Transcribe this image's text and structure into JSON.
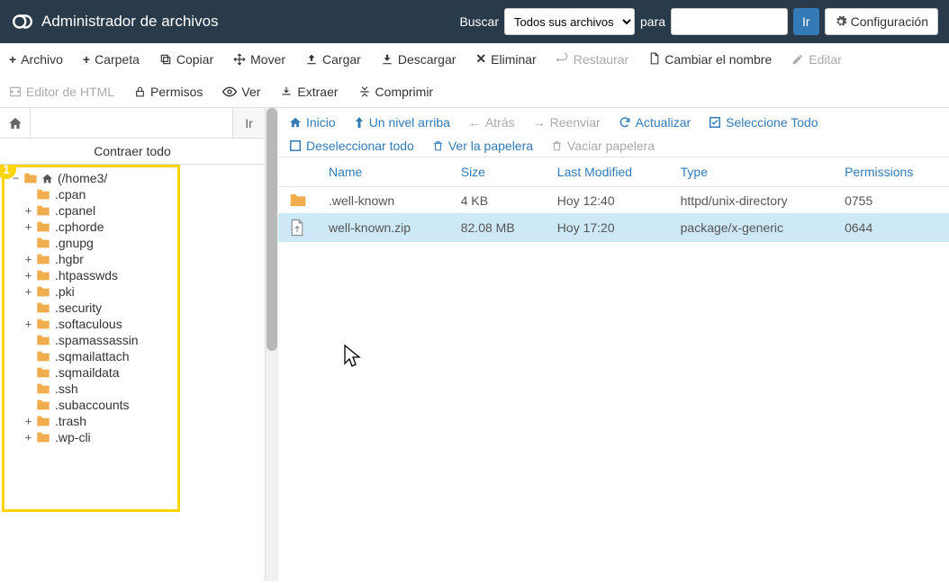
{
  "header": {
    "title": "Administrador de archivos",
    "search_label": "Buscar",
    "select_value": "Todos sus archivos",
    "para_label": "para",
    "go_btn": "Ir",
    "settings_btn": "Configuración"
  },
  "toolbar": {
    "file": "Archivo",
    "folder": "Carpeta",
    "copy": "Copiar",
    "move": "Mover",
    "upload": "Cargar",
    "download": "Descargar",
    "delete": "Eliminar",
    "restore": "Restaurar",
    "rename": "Cambiar el nombre",
    "edit": "Editar",
    "htmledit": "Editor de HTML",
    "permissions": "Permisos",
    "view": "Ver",
    "extract": "Extraer",
    "compress": "Comprimir"
  },
  "sidebar": {
    "go": "Ir",
    "collapse_all": "Contraer todo",
    "root_label": "(/home3/",
    "nodes": [
      {
        "toggle": "",
        "label": ".cpan"
      },
      {
        "toggle": "+",
        "label": ".cpanel"
      },
      {
        "toggle": "+",
        "label": ".cphorde"
      },
      {
        "toggle": "",
        "label": ".gnupg"
      },
      {
        "toggle": "+",
        "label": ".hgbr"
      },
      {
        "toggle": "+",
        "label": ".htpasswds"
      },
      {
        "toggle": "+",
        "label": ".pki"
      },
      {
        "toggle": "",
        "label": ".security"
      },
      {
        "toggle": "+",
        "label": ".softaculous"
      },
      {
        "toggle": "",
        "label": ".spamassassin"
      },
      {
        "toggle": "",
        "label": ".sqmailattach"
      },
      {
        "toggle": "",
        "label": ".sqmaildata"
      },
      {
        "toggle": "",
        "label": ".ssh"
      },
      {
        "toggle": "",
        "label": ".subaccounts"
      },
      {
        "toggle": "+",
        "label": ".trash"
      },
      {
        "toggle": "+",
        "label": ".wp-cli"
      }
    ]
  },
  "actions": {
    "home": "Inicio",
    "up": "Un nivel arriba",
    "back": "Atrás",
    "forward": "Reenviar",
    "reload": "Actualizar",
    "select_all": "Seleccione Todo",
    "deselect_all": "Deseleccionar todo",
    "view_trash": "Ver la papelera",
    "empty_trash": "Vaciar papelera"
  },
  "table": {
    "headers": {
      "name": "Name",
      "size": "Size",
      "modified": "Last Modified",
      "type": "Type",
      "perms": "Permissions"
    },
    "rows": [
      {
        "icon": "folder",
        "name": ".well-known",
        "size": "4 KB",
        "modified": "Hoy 12:40",
        "type": "httpd/unix-directory",
        "perms": "0755",
        "selected": false
      },
      {
        "icon": "file",
        "name": "well-known.zip",
        "size": "82.08 MB",
        "modified": "Hoy 17:20",
        "type": "package/x-generic",
        "perms": "0644",
        "selected": true
      }
    ]
  },
  "annotation": {
    "badge": "1"
  }
}
